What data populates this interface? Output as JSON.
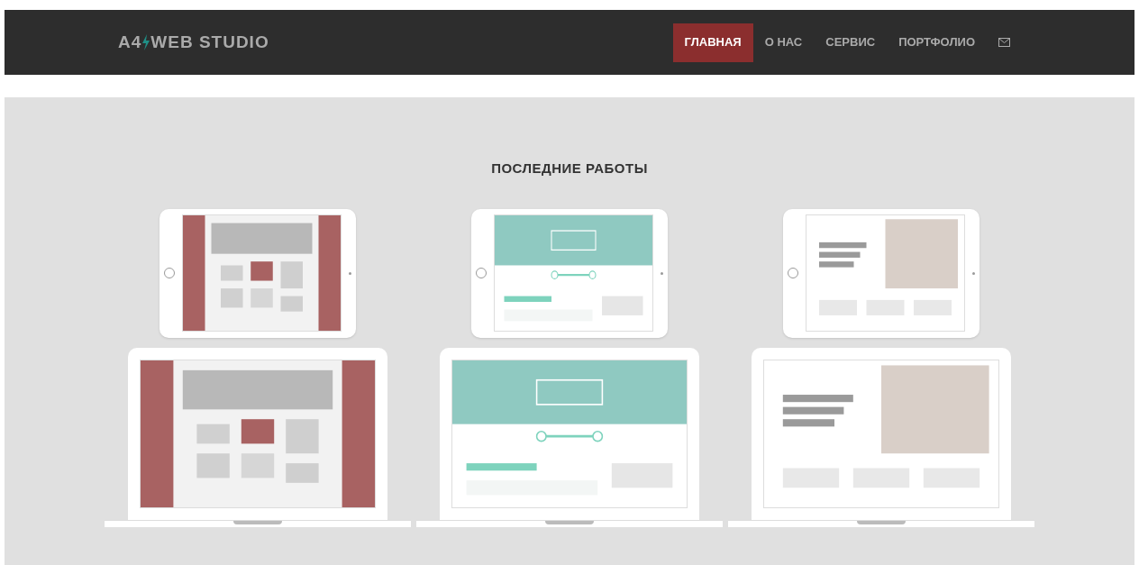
{
  "header": {
    "logo": {
      "left": "A4",
      "right": "WEB STUDIO"
    },
    "nav": [
      {
        "label": "ГЛАВНАЯ",
        "selected": true
      },
      {
        "label": "О НАС",
        "selected": false
      },
      {
        "label": "СЕРВИС",
        "selected": false
      },
      {
        "label": "ПОРТФОЛИО",
        "selected": false
      }
    ]
  },
  "portfolio": {
    "title": "ПОСЛЕДНИЕ РАБОТЫ",
    "rows": [
      [
        {
          "kind": "tablet"
        },
        {
          "kind": "tablet"
        },
        {
          "kind": "tablet"
        }
      ],
      [
        {
          "kind": "laptop"
        },
        {
          "kind": "laptop"
        },
        {
          "kind": "laptop"
        }
      ]
    ]
  }
}
